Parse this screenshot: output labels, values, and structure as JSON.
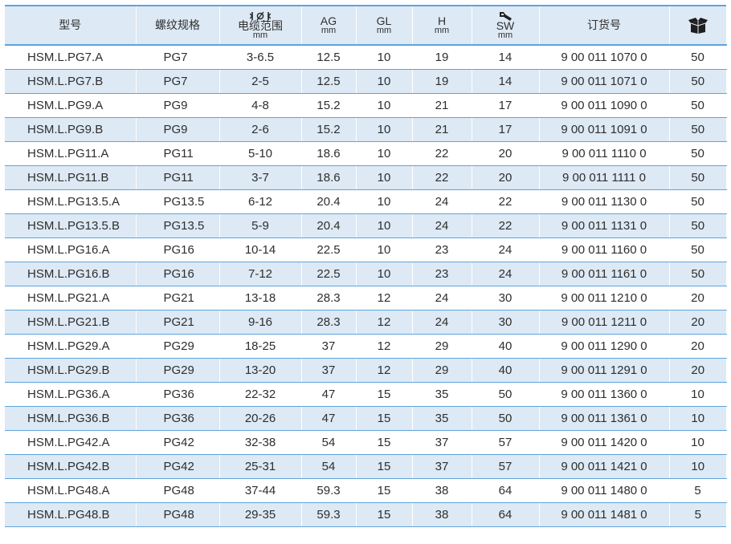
{
  "headers": {
    "model": "型号",
    "thread": "螺纹规格",
    "cable_symbol": "Ι⌀Ι",
    "cable": "电缆范围",
    "cable_unit": "mm",
    "ag": "AG",
    "ag_unit": "mm",
    "gl": "GL",
    "gl_unit": "mm",
    "h": "H",
    "h_unit": "mm",
    "sw": "SW",
    "sw_unit": "mm",
    "order": "订货号",
    "pack_icon": "box-icon",
    "sw_icon": "wrench-icon"
  },
  "rows": [
    {
      "model": "HSM.L.PG7.A",
      "thread": "PG7",
      "cable": "3-6.5",
      "ag": "12.5",
      "gl": "10",
      "h": "19",
      "sw": "14",
      "order": "9 00 011 1070 0",
      "pack": "50"
    },
    {
      "model": "HSM.L.PG7.B",
      "thread": "PG7",
      "cable": "2-5",
      "ag": "12.5",
      "gl": "10",
      "h": "19",
      "sw": "14",
      "order": "9 00 011 1071 0",
      "pack": "50"
    },
    {
      "model": "HSM.L.PG9.A",
      "thread": "PG9",
      "cable": "4-8",
      "ag": "15.2",
      "gl": "10",
      "h": "21",
      "sw": "17",
      "order": "9 00 011 1090 0",
      "pack": "50"
    },
    {
      "model": "HSM.L.PG9.B",
      "thread": "PG9",
      "cable": "2-6",
      "ag": "15.2",
      "gl": "10",
      "h": "21",
      "sw": "17",
      "order": "9 00 011 1091 0",
      "pack": "50"
    },
    {
      "model": "HSM.L.PG11.A",
      "thread": "PG11",
      "cable": "5-10",
      "ag": "18.6",
      "gl": "10",
      "h": "22",
      "sw": "20",
      "order": "9 00 011 1110 0",
      "pack": "50"
    },
    {
      "model": "HSM.L.PG11.B",
      "thread": "PG11",
      "cable": "3-7",
      "ag": "18.6",
      "gl": "10",
      "h": "22",
      "sw": "20",
      "order": "9 00 011 1111 0",
      "pack": "50"
    },
    {
      "model": "HSM.L.PG13.5.A",
      "thread": "PG13.5",
      "cable": "6-12",
      "ag": "20.4",
      "gl": "10",
      "h": "24",
      "sw": "22",
      "order": "9 00 011 1130 0",
      "pack": "50"
    },
    {
      "model": "HSM.L.PG13.5.B",
      "thread": "PG13.5",
      "cable": "5-9",
      "ag": "20.4",
      "gl": "10",
      "h": "24",
      "sw": "22",
      "order": "9 00 011 1131 0",
      "pack": "50"
    },
    {
      "model": "HSM.L.PG16.A",
      "thread": "PG16",
      "cable": "10-14",
      "ag": "22.5",
      "gl": "10",
      "h": "23",
      "sw": "24",
      "order": "9 00 011 1160 0",
      "pack": "50"
    },
    {
      "model": "HSM.L.PG16.B",
      "thread": "PG16",
      "cable": "7-12",
      "ag": "22.5",
      "gl": "10",
      "h": "23",
      "sw": "24",
      "order": "9 00 011 1161 0",
      "pack": "50"
    },
    {
      "model": "HSM.L.PG21.A",
      "thread": "PG21",
      "cable": "13-18",
      "ag": "28.3",
      "gl": "12",
      "h": "24",
      "sw": "30",
      "order": "9 00 011 1210 0",
      "pack": "20"
    },
    {
      "model": "HSM.L.PG21.B",
      "thread": "PG21",
      "cable": "9-16",
      "ag": "28.3",
      "gl": "12",
      "h": "24",
      "sw": "30",
      "order": "9 00 011 1211 0",
      "pack": "20"
    },
    {
      "model": "HSM.L.PG29.A",
      "thread": "PG29",
      "cable": "18-25",
      "ag": "37",
      "gl": "12",
      "h": "29",
      "sw": "40",
      "order": "9 00 011 1290 0",
      "pack": "20"
    },
    {
      "model": "HSM.L.PG29.B",
      "thread": "PG29",
      "cable": "13-20",
      "ag": "37",
      "gl": "12",
      "h": "29",
      "sw": "40",
      "order": "9 00 011 1291 0",
      "pack": "20"
    },
    {
      "model": "HSM.L.PG36.A",
      "thread": "PG36",
      "cable": "22-32",
      "ag": "47",
      "gl": "15",
      "h": "35",
      "sw": "50",
      "order": "9 00 011 1360 0",
      "pack": "10"
    },
    {
      "model": "HSM.L.PG36.B",
      "thread": "PG36",
      "cable": "20-26",
      "ag": "47",
      "gl": "15",
      "h": "35",
      "sw": "50",
      "order": "9 00 011 1361 0",
      "pack": "10"
    },
    {
      "model": "HSM.L.PG42.A",
      "thread": "PG42",
      "cable": "32-38",
      "ag": "54",
      "gl": "15",
      "h": "37",
      "sw": "57",
      "order": "9 00 011 1420 0",
      "pack": "10"
    },
    {
      "model": "HSM.L.PG42.B",
      "thread": "PG42",
      "cable": "25-31",
      "ag": "54",
      "gl": "15",
      "h": "37",
      "sw": "57",
      "order": "9 00 011 1421 0",
      "pack": "10"
    },
    {
      "model": "HSM.L.PG48.A",
      "thread": "PG48",
      "cable": "37-44",
      "ag": "59.3",
      "gl": "15",
      "h": "38",
      "sw": "64",
      "order": "9 00 011 1480 0",
      "pack": "5"
    },
    {
      "model": "HSM.L.PG48.B",
      "thread": "PG48",
      "cable": "29-35",
      "ag": "59.3",
      "gl": "15",
      "h": "38",
      "sw": "64",
      "order": "9 00 011 1481 0",
      "pack": "5"
    }
  ],
  "colors": {
    "header_bg": "#dde9f4",
    "stripe_bg": "#dde9f4",
    "rule": "#5fa4dc"
  }
}
